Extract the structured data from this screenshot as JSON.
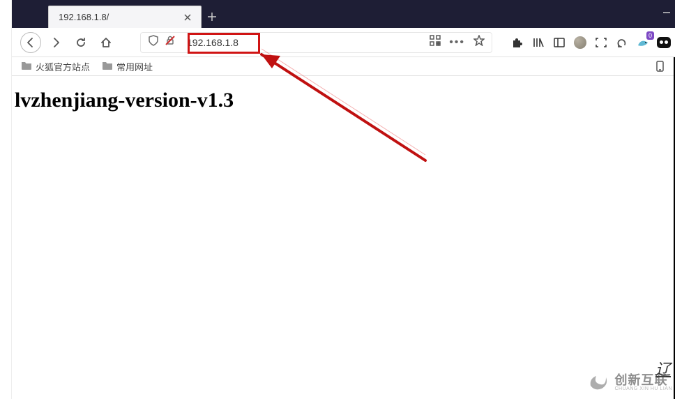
{
  "tab": {
    "title": "192.168.1.8/"
  },
  "addressbar": {
    "url": "192.168.1.8"
  },
  "bookmarks": {
    "items": [
      {
        "label": "火狐官方站点"
      },
      {
        "label": "常用网址"
      }
    ]
  },
  "page": {
    "heading": "lvzhenjiang-version-v1.3"
  },
  "extensions": {
    "shark_badge": "0"
  },
  "watermark": {
    "main": "创新互联",
    "sub": "CHUANG XIN HU LIAN"
  },
  "corner_glyph": "辽"
}
